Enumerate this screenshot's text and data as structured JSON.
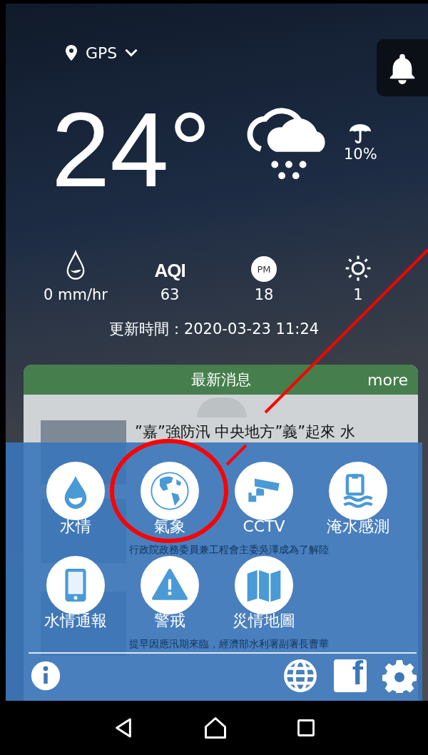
{
  "location": {
    "label": "GPS"
  },
  "current": {
    "temperature": "24°",
    "rain_chance": "10%"
  },
  "stats": [
    {
      "kind": "rainfall",
      "value": "0 mm/hr"
    },
    {
      "kind": "aqi",
      "label": "AQI",
      "value": "63"
    },
    {
      "kind": "pm",
      "label": "PM",
      "value": "18"
    },
    {
      "kind": "uv",
      "value": "1"
    }
  ],
  "updated": "更新時間：2020-03-23 11:24",
  "news": {
    "title": "最新消息",
    "more": "more",
    "items": [
      {
        "title": "”嘉”強防汛 中央地方”義”起來 水"
      },
      {
        "snippet": "行政院政務委員兼工程會主委吳澤成為了解陸"
      },
      {
        "snippet": "提早因應汛期來臨，經濟部水利署副署長曹華"
      }
    ]
  },
  "menu": [
    {
      "kind": "water",
      "label": "水情"
    },
    {
      "kind": "globe",
      "label": "氣象"
    },
    {
      "kind": "cctv",
      "label": "CCTV"
    },
    {
      "kind": "flood-sensor",
      "label": "淹水感測"
    },
    {
      "kind": "phone",
      "label": "水情通報"
    },
    {
      "kind": "warning",
      "label": "警戒"
    },
    {
      "kind": "map",
      "label": "災情地圖"
    }
  ],
  "footer": {
    "facebook": "f"
  }
}
